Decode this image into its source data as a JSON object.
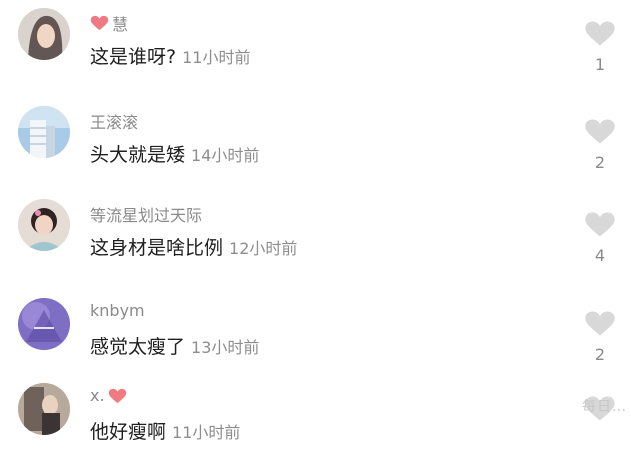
{
  "comments": [
    {
      "user": "慧",
      "text": "这是谁呀?",
      "time": "11小时前",
      "likes": "1",
      "user_badge": "heart-emoji"
    },
    {
      "user": "王滚滚",
      "text": "头大就是矮",
      "time": "14小时前",
      "likes": "2"
    },
    {
      "user": "等流星划过天际",
      "text": "这身材是啥比例",
      "time": "12小时前",
      "likes": "4"
    },
    {
      "user": "knbym",
      "text": "感觉太瘦了",
      "time": "13小时前",
      "likes": "2"
    },
    {
      "user": "x.",
      "text": "他好瘦啊",
      "time": "11小时前",
      "likes": "",
      "user_badge": "heart-emoji"
    }
  ],
  "watermark": "每日…",
  "colors": {
    "heart": "#f07a82",
    "like_icon": "#d8d8d8",
    "username": "#8a8a8a"
  }
}
